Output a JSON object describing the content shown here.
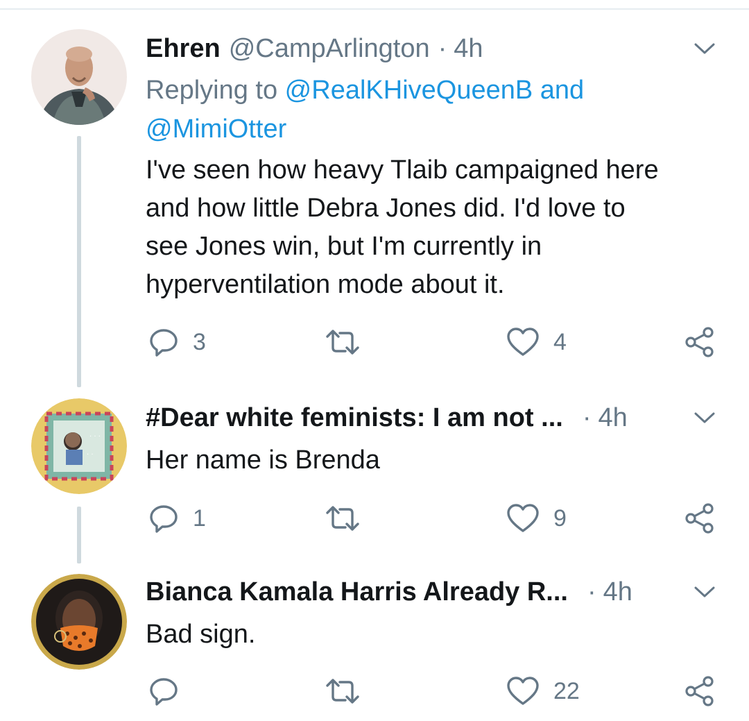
{
  "tweets": [
    {
      "name": "Ehren",
      "handle": "@CampArlington",
      "separator": "·",
      "time": "4h",
      "replying_prefix": "Replying to ",
      "mention_1": "@RealKHiveQueenB",
      "replying_and": " and",
      "mention_2": "@MimiOtter",
      "text_lines": [
        "I've seen how heavy Tlaib campaigned here",
        "and how little Debra Jones did. I'd love to",
        "see Jones win, but I'm currently in",
        "hyperventilation mode about it."
      ],
      "reply_count": "3",
      "like_count": "4"
    },
    {
      "name": "#Dear white feminists: I am not ...",
      "separator": "·",
      "time": "4h",
      "text": "Her name is Brenda",
      "reply_count": "1",
      "like_count": "9"
    },
    {
      "name": "Bianca Kamala Harris Already R...",
      "separator": "·",
      "time": "4h",
      "text": "Bad sign.",
      "reply_count": "",
      "like_count": "22"
    }
  ],
  "icons": {
    "reply": "reply-icon",
    "retweet": "retweet-icon",
    "like": "heart-icon",
    "share": "share-icon",
    "menu": "chevron-down-icon"
  },
  "colors": {
    "link": "#1b95e0",
    "secondary_text": "#657786",
    "thread_line": "#cfd9de"
  }
}
